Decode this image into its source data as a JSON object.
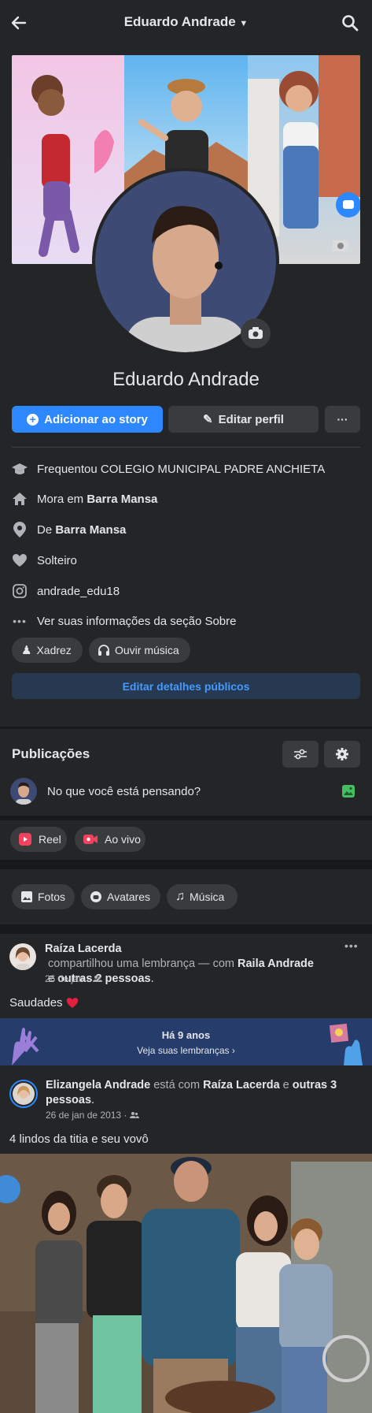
{
  "header": {
    "title": "Eduardo Andrade"
  },
  "profile": {
    "name": "Eduardo Andrade",
    "add_story": "Adicionar ao story",
    "edit_profile": "Editar perfil",
    "more": "···"
  },
  "about": {
    "studied": "Frequentou COLEGIO MUNICIPAL PADRE ANCHIETA",
    "lives_prefix": "Mora em ",
    "lives_city": "Barra Mansa",
    "from_prefix": "De ",
    "from_city": "Barra Mansa",
    "relationship": "Solteiro",
    "instagram": "andrade_edu18",
    "see_more": "Ver suas informações da seção Sobre",
    "hobbies": [
      "Xadrez",
      "Ouvir música"
    ],
    "edit_public": "Editar detalhes públicos"
  },
  "posts": {
    "heading": "Publicações",
    "composer_placeholder": "No que você está pensando?",
    "reel": "Reel",
    "live": "Ao vivo",
    "filters": [
      "Fotos",
      "Avatares",
      "Música"
    ]
  },
  "post": {
    "author": "Raíza Lacerda",
    "action": " compartilhou uma lembrança — com ",
    "with1": "Raila Andrade",
    "and": " e ",
    "with2": "outras 2 pessoas",
    "dot": ".",
    "date": "26 de jan ·",
    "text": "Saudades",
    "memory_title": "Há 9 anos",
    "memory_sub": "Veja suas lembranças",
    "shared_author": "Elizangela Andrade",
    "shared_action": " está com ",
    "shared_with1": "Raíza Lacerda",
    "shared_and": " e ",
    "shared_with2": "outras 3 pessoas",
    "shared_dot": ".",
    "shared_date": "26 de jan de 2013 ·",
    "shared_text": "4 lindos da titia e seu vovô"
  },
  "colors": {
    "accent": "#2d88ff",
    "bg": "#18191a",
    "card": "#242526",
    "button": "#3a3b3c",
    "memory_bg": "#263c6b"
  }
}
